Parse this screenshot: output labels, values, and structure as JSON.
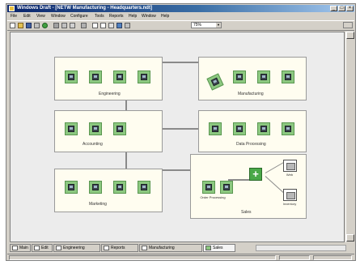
{
  "window": {
    "title": "Windows Draft - [NETW Manufacturing - Headquarters.ndt]",
    "controls": [
      "_",
      "□",
      "×"
    ]
  },
  "menu": [
    "File",
    "Edit",
    "View",
    "Window",
    "Configure",
    "Tools",
    "Reports",
    "Help",
    "Window",
    "Help"
  ],
  "toolbar": {
    "zoom_value": "75%"
  },
  "groups": [
    {
      "id": "engineering",
      "label": "Engineering"
    },
    {
      "id": "manufacturing",
      "label": "Manufacturing"
    },
    {
      "id": "accounting",
      "label": "Accounting"
    },
    {
      "id": "data_processing",
      "label": "Data Processing"
    },
    {
      "id": "marketing",
      "label": "Marketing"
    },
    {
      "id": "sales",
      "label": "Sales"
    }
  ],
  "sales_nodes": {
    "order_processing": "Order Processing",
    "server_1": "Web",
    "server_2": "Inventory"
  },
  "tabs": [
    {
      "label": "Main",
      "active": false
    },
    {
      "label": "Edit",
      "active": false
    },
    {
      "label": "Engineering",
      "active": false
    },
    {
      "label": "Reports",
      "active": false
    },
    {
      "label": "Manufacturing",
      "active": false
    },
    {
      "label": "Sales",
      "active": true
    }
  ],
  "colors": {
    "node_fill": "#8cc880",
    "group_fill": "#fffdf0",
    "titlebar": "#0a246a"
  }
}
